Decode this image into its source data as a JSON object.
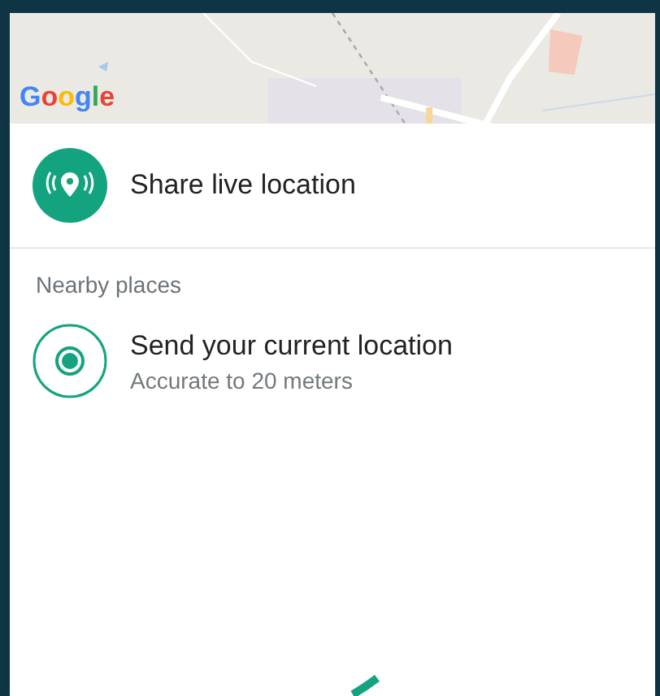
{
  "map": {
    "logo": "Google"
  },
  "live_location": {
    "label": "Share live location"
  },
  "section_title": "Nearby places",
  "places": [
    {
      "kind": "current",
      "title": "Send your current location",
      "subtitle": "Accurate to 20 meters"
    }
  ],
  "loading": true
}
